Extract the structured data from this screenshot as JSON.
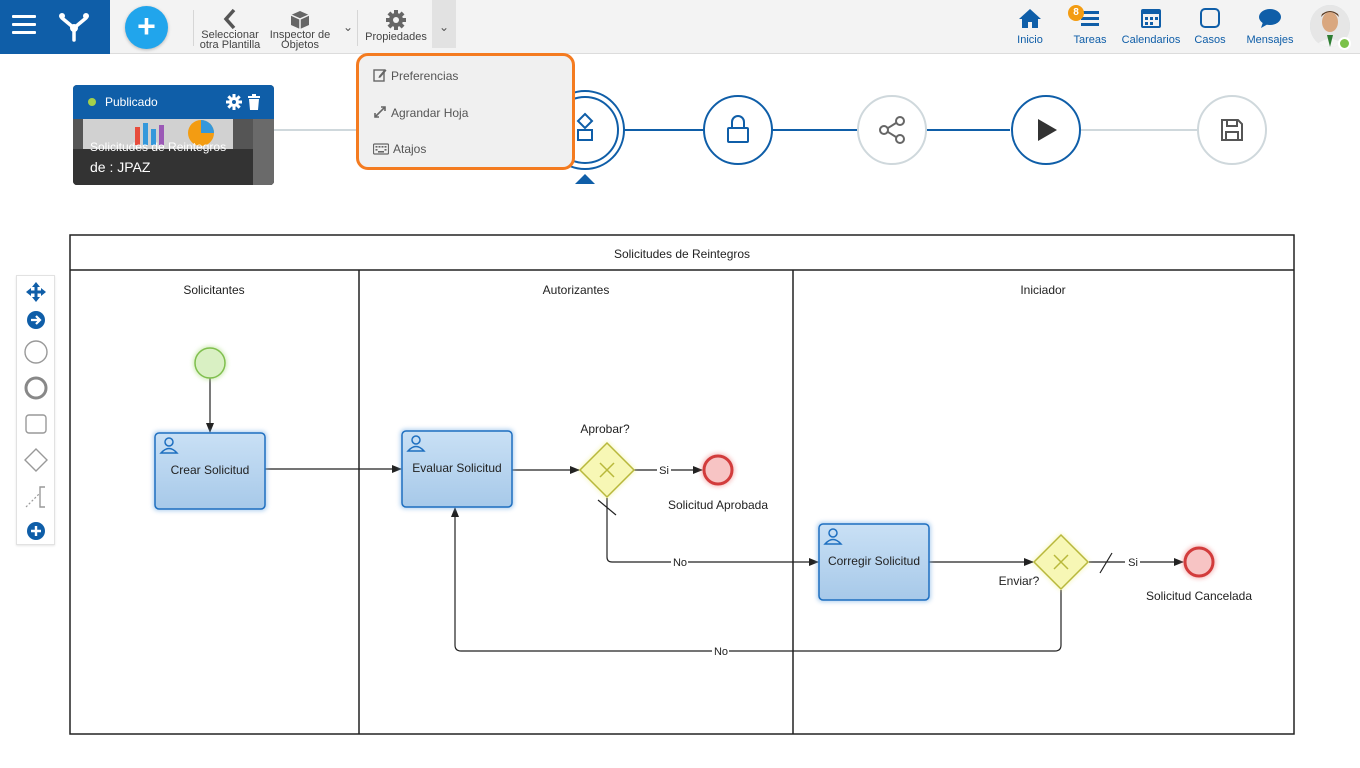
{
  "toolbar": {
    "select_template": "Seleccionar otra Plantilla",
    "select_template_l1": "Seleccionar",
    "select_template_l2": "otra Plantilla",
    "object_inspector_l1": "Inspector de",
    "object_inspector_l2": "Objetos",
    "properties": "Propiedades"
  },
  "nav": {
    "home": "Inicio",
    "tasks": "Tareas",
    "tasks_count": "8",
    "calendars": "Calendarios",
    "cases": "Casos",
    "messages": "Mensajes"
  },
  "dropdown": {
    "items": [
      {
        "label": "Preferencias",
        "icon": "edit-icon"
      },
      {
        "label": "Agrandar Hoja",
        "icon": "expand-icon"
      },
      {
        "label": "Atajos",
        "icon": "keyboard-icon"
      }
    ]
  },
  "card": {
    "status": "Publicado",
    "title": "Solicitudes de Reintegros",
    "author": "de : JPAZ"
  },
  "stepper": {
    "steps": [
      "diagram-icon",
      "lock-icon",
      "share-icon",
      "play-icon",
      "save-icon"
    ]
  },
  "diagram": {
    "pool_title": "Solicitudes de Reintegros",
    "lanes": [
      "Solicitantes",
      "Autorizantes",
      "Iniciador"
    ],
    "tasks": {
      "create": "Crear Solicitud",
      "evaluate": "Evaluar Solicitud",
      "correct": "Corregir Solicitud"
    },
    "gateways": {
      "approve": "Aprobar?",
      "send": "Enviar?"
    },
    "flows": {
      "yes1": "Si",
      "no1": "No",
      "yes2": "Si",
      "no2": "No"
    },
    "end_events": {
      "approved": "Solicitud Aprobada",
      "cancelled": "Solicitud Cancelada"
    }
  },
  "colors": {
    "brand": "#0f5ea8",
    "accent": "#21a5ec",
    "highlight": "#f47b20",
    "task_fill": "#a9cdec",
    "gateway_fill": "#f5f5b0",
    "start_fill": "#d6f0c0",
    "end_fill": "#f5b0b0"
  }
}
